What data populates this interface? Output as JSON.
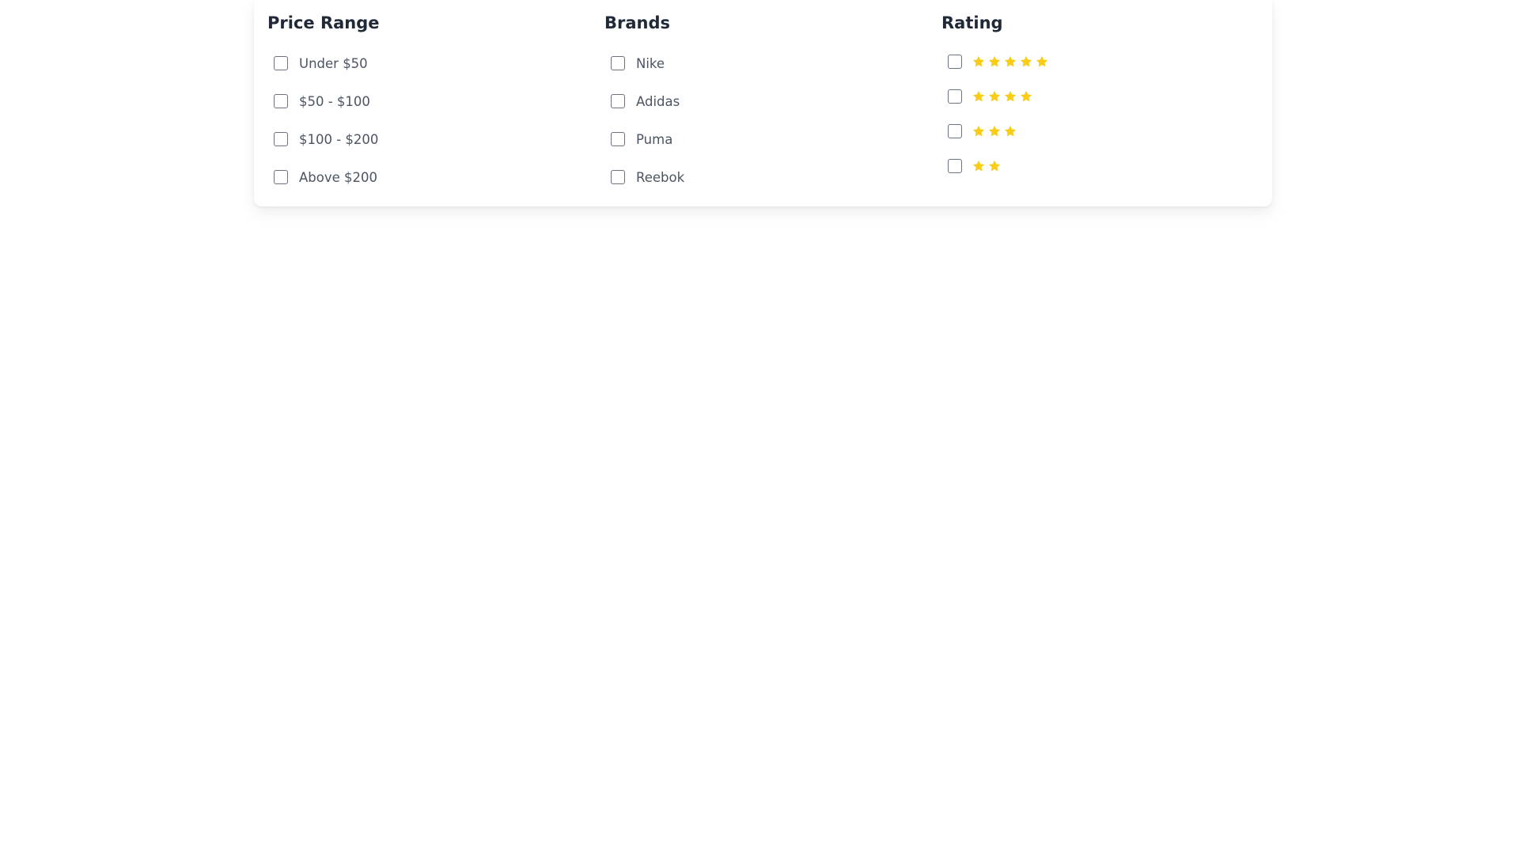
{
  "filters": {
    "price_range": {
      "title": "Price Range",
      "options": [
        "Under $50",
        "$50 - $100",
        "$100 - $200",
        "Above $200"
      ]
    },
    "brands": {
      "title": "Brands",
      "options": [
        "Nike",
        "Adidas",
        "Puma",
        "Reebok"
      ]
    },
    "rating": {
      "title": "Rating",
      "options": [
        {
          "stars": 5,
          "icon": "star-icon"
        },
        {
          "stars": 4,
          "icon": "star-icon"
        },
        {
          "stars": 3,
          "icon": "star-icon"
        },
        {
          "stars": 2,
          "icon": "star-icon"
        }
      ]
    }
  },
  "colors": {
    "star": "#facc15",
    "heading": "#1f2937",
    "label": "#4b5563",
    "checkbox_border": "#6b7280"
  }
}
